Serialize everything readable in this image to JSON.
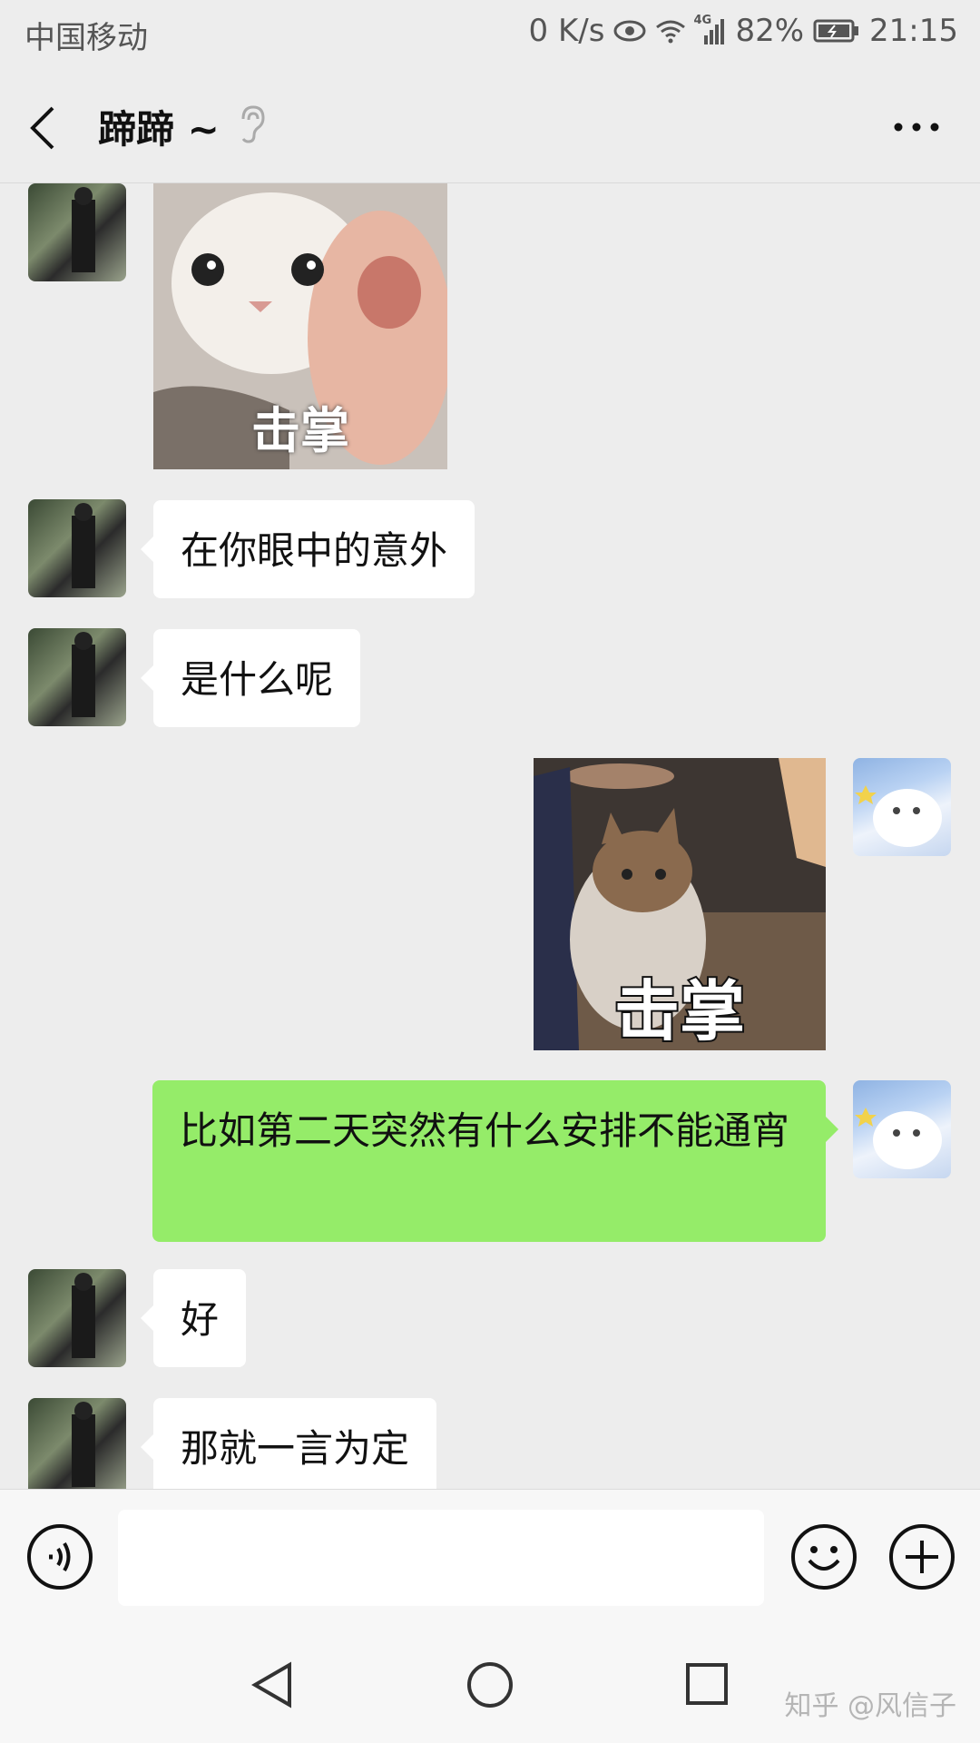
{
  "status_bar": {
    "carrier": "中国移动",
    "network_speed": "0 K/s",
    "signal_type": "4G",
    "battery": "82%",
    "time": "21:15"
  },
  "header": {
    "title": "蹄蹄 ~",
    "icons": [
      "back-icon",
      "ear-icon",
      "more-icon"
    ]
  },
  "messages": [
    {
      "side": "left",
      "type": "sticker",
      "caption": "击掌"
    },
    {
      "side": "left",
      "type": "text",
      "text": "在你眼中的意外"
    },
    {
      "side": "left",
      "type": "text",
      "text": "是什么呢"
    },
    {
      "side": "right",
      "type": "sticker",
      "caption": "击掌"
    },
    {
      "side": "right",
      "type": "text",
      "text": "比如第二天突然有什么安排不能通宵"
    },
    {
      "side": "left",
      "type": "text",
      "text": "好"
    },
    {
      "side": "left",
      "type": "text",
      "text": "那就一言为定"
    }
  ],
  "input_bar": {
    "placeholder": "",
    "icons": [
      "voice-icon",
      "emoji-icon",
      "plus-icon"
    ]
  },
  "nav_bar": {
    "icons": [
      "back-triangle-icon",
      "home-circle-icon",
      "recent-square-icon"
    ]
  },
  "watermark": "知乎 @风信子",
  "colors": {
    "background": "#ededed",
    "bubble_right": "#95ec69",
    "bubble_left": "#ffffff"
  }
}
